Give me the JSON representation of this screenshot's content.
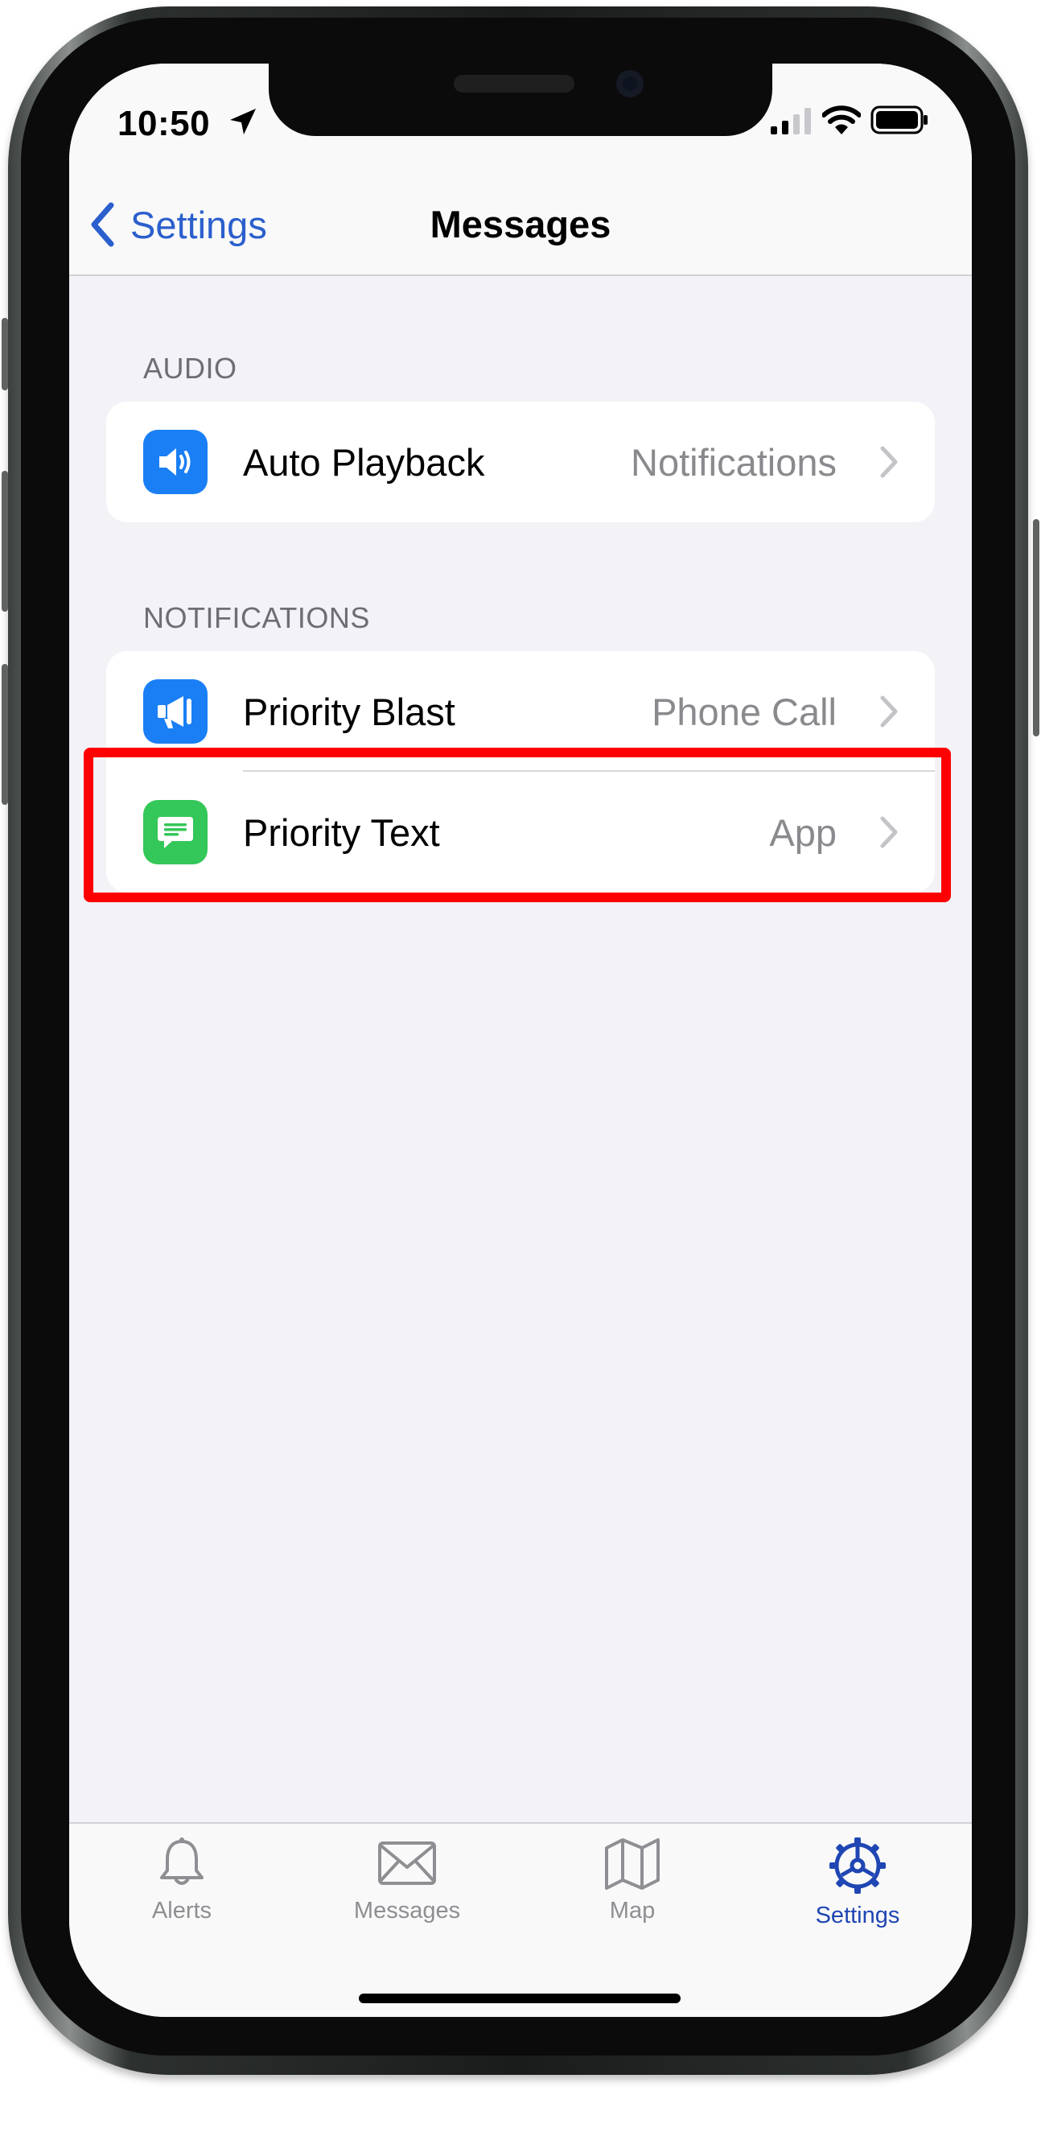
{
  "status_bar": {
    "time": "10:50"
  },
  "nav": {
    "back_label": "Settings",
    "title": "Messages"
  },
  "sections": [
    {
      "header": "AUDIO",
      "rows": [
        {
          "label": "Auto Playback",
          "value": "Notifications",
          "icon": "speaker-icon",
          "icon_color": "#1a7ff5"
        }
      ]
    },
    {
      "header": "NOTIFICATIONS",
      "rows": [
        {
          "label": "Priority Blast",
          "value": "Phone Call",
          "icon": "megaphone-icon",
          "icon_color": "#1a7ff5"
        },
        {
          "label": "Priority Text",
          "value": "App",
          "icon": "message-bubble-icon",
          "icon_color": "#34c759",
          "highlighted": true
        }
      ]
    }
  ],
  "tabs": [
    {
      "label": "Alerts",
      "icon": "bell-icon",
      "active": false
    },
    {
      "label": "Messages",
      "icon": "envelope-icon",
      "active": false
    },
    {
      "label": "Map",
      "icon": "map-icon",
      "active": false
    },
    {
      "label": "Settings",
      "icon": "gear-icon",
      "active": true
    }
  ],
  "colors": {
    "accent": "#2b5fcd",
    "inactive_tab": "#8e8e93",
    "highlight": "#ff0000"
  }
}
